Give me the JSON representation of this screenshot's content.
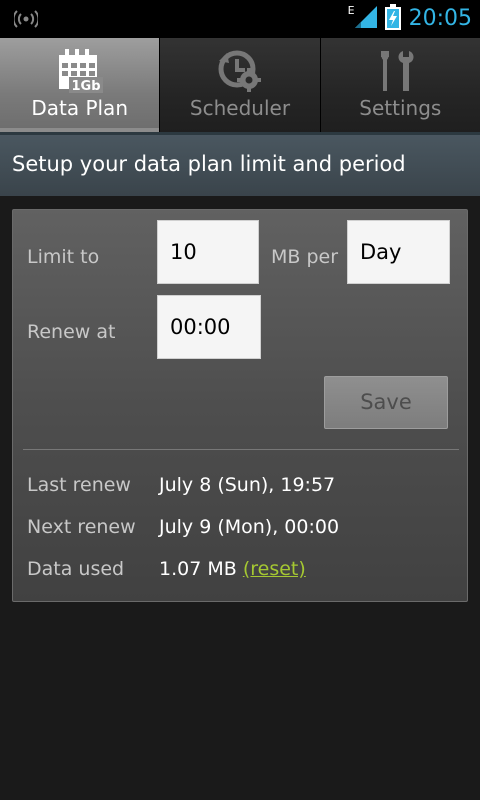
{
  "status_bar": {
    "time": "20:05",
    "network_type": "E",
    "icons": [
      "wireless-icon",
      "signal-icon",
      "battery-icon"
    ],
    "time_color": "#33b5e5"
  },
  "tabs": [
    {
      "label": "Data Plan",
      "icon": "calendar-1gb-icon",
      "icon_text": "1Gb",
      "active": true
    },
    {
      "label": "Scheduler",
      "icon": "clock-gear-icon",
      "active": false
    },
    {
      "label": "Settings",
      "icon": "tools-icon",
      "active": false
    }
  ],
  "header": {
    "title": "Setup your data plan limit and period"
  },
  "form": {
    "limit_label": "Limit to",
    "limit_value": "10",
    "unit_label": "MB per",
    "period_value": "Day",
    "renew_label": "Renew at",
    "renew_value": "00:00",
    "save_label": "Save"
  },
  "info": {
    "last_renew_label": "Last renew",
    "last_renew_value": "July 8 (Sun), 19:57",
    "next_renew_label": "Next renew",
    "next_renew_value": "July 9 (Mon), 00:00",
    "data_used_label": "Data used",
    "data_used_value": "1.07 MB",
    "reset_label": "(reset)"
  },
  "colors": {
    "accent": "#33b5e5",
    "link": "#a5c832",
    "background": "#1a1a1a"
  }
}
